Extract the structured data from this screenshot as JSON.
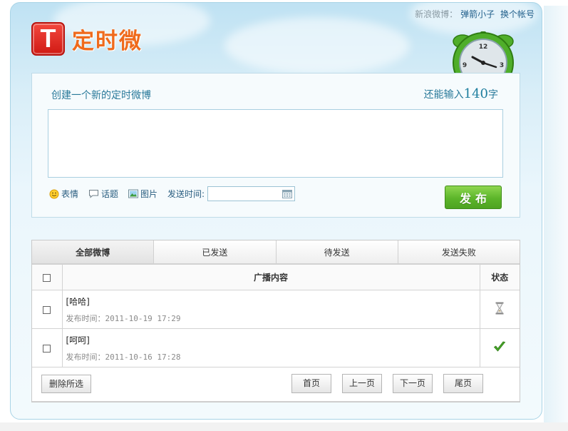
{
  "user": {
    "prefix": "新浪微博：",
    "name": "弹箭小子",
    "switch_label": "换个帐号"
  },
  "logo": {
    "icon_letter": "T",
    "text": "定时微"
  },
  "compose": {
    "title": "创建一个新的定时微博",
    "counter_prefix": "还能输入",
    "counter_value": "140",
    "counter_suffix": "字",
    "textarea_value": "",
    "tools": {
      "emoji": "表情",
      "topic": "话题",
      "image": "图片"
    },
    "send_time_label": "发送时间:",
    "send_time_value": "",
    "publish_label": "发布"
  },
  "list": {
    "tabs": [
      {
        "label": "全部微博",
        "active": true
      },
      {
        "label": "已发送",
        "active": false
      },
      {
        "label": "待发送",
        "active": false
      },
      {
        "label": "发送失败",
        "active": false
      }
    ],
    "columns": {
      "content": "广播内容",
      "status": "状态"
    },
    "rows": [
      {
        "text": "[哈哈]",
        "time_label": "发布时间：",
        "time": "2011-10-19 17:29",
        "status": "pending"
      },
      {
        "text": "[呵呵]",
        "time_label": "发布时间：",
        "time": "2011-10-16 17:28",
        "status": "sent"
      }
    ],
    "delete_label": "删除所选",
    "pager": {
      "first": "首页",
      "prev": "上一页",
      "next": "下一页",
      "last": "尾页"
    }
  },
  "colors": {
    "brand_red": "#d01a14",
    "logo_orange": "#ef6a1c",
    "publish_green": "#5cb52a",
    "link_blue": "#1f5e8a"
  }
}
